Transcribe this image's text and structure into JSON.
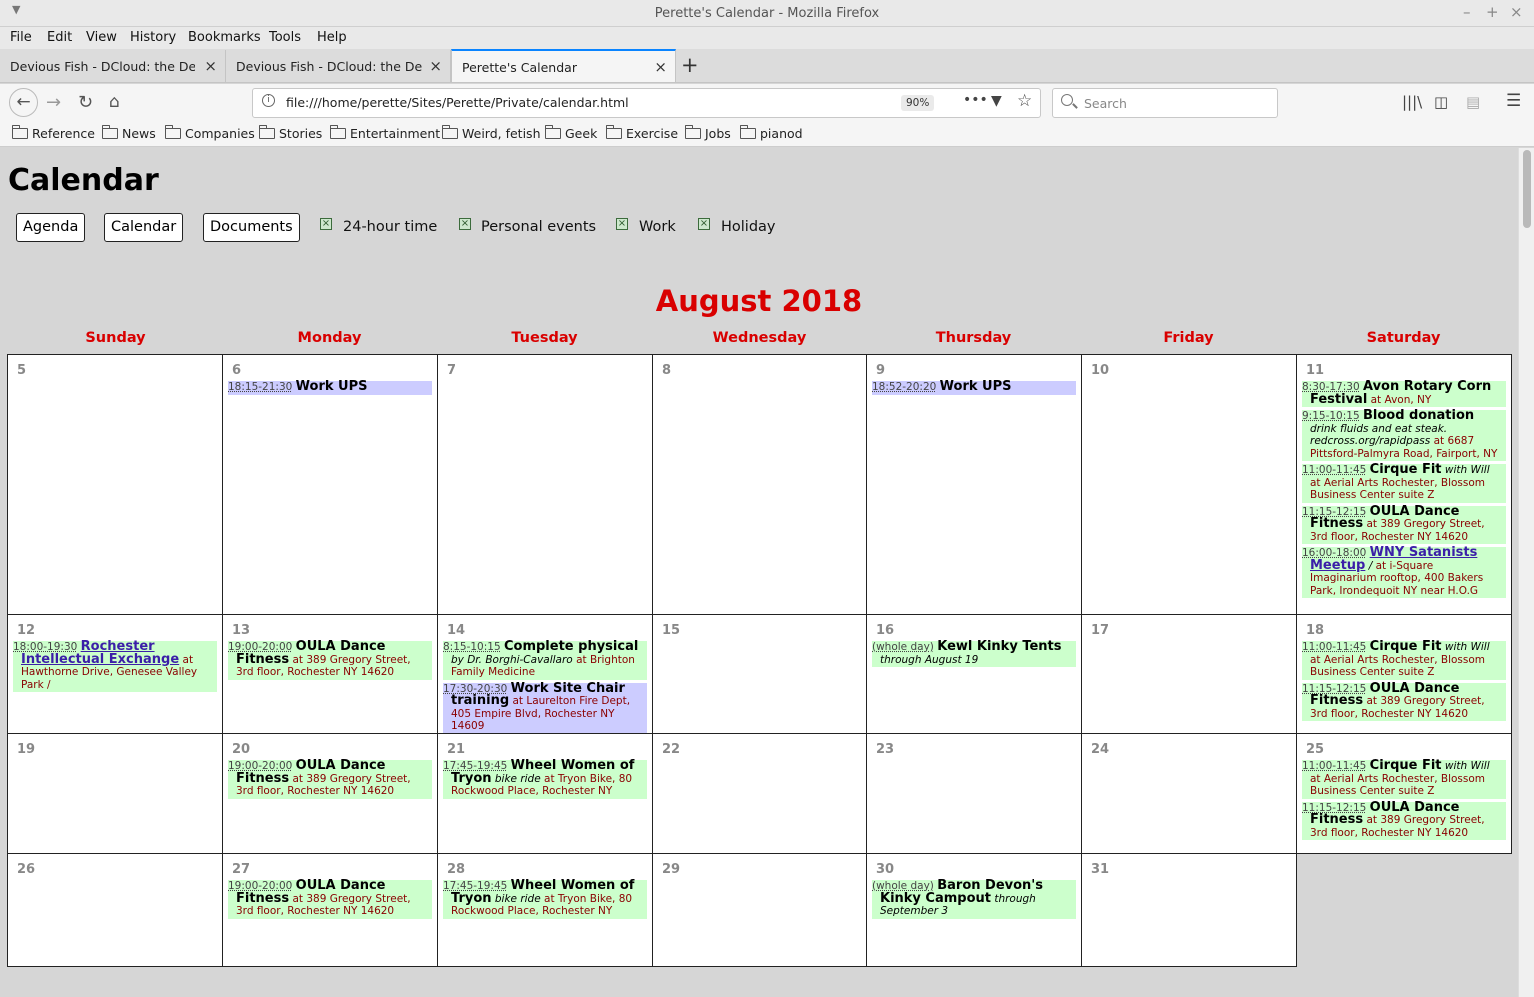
{
  "window": {
    "title": "Perette's Calendar - Mozilla Firefox"
  },
  "menu": [
    "File",
    "Edit",
    "View",
    "History",
    "Bookmarks",
    "Tools",
    "Help"
  ],
  "tabs": [
    {
      "label": "Devious Fish - DCloud: the Devio"
    },
    {
      "label": "Devious Fish - DCloud: the Devio"
    },
    {
      "label": "Perette's Calendar"
    }
  ],
  "nav": {
    "url": "file:///home/perette/Sites/Perette/Private/calendar.html",
    "zoom": "90%",
    "search_placeholder": "Search"
  },
  "bookmarks": [
    "Reference",
    "News",
    "Companies",
    "Stories",
    "Entertainment",
    "Weird, fetish",
    "Geek",
    "Exercise",
    "Jobs",
    "pianod"
  ],
  "page": {
    "title": "Calendar",
    "buttons": [
      "Agenda",
      "Calendar",
      "Documents"
    ],
    "toggles": [
      {
        "label": "24-hour time",
        "checked": true
      },
      {
        "label": "Personal events",
        "checked": true
      },
      {
        "label": "Work",
        "checked": true
      },
      {
        "label": "Holiday",
        "checked": true
      }
    ],
    "month": "August 2018",
    "weekdays": [
      "Sunday",
      "Monday",
      "Tuesday",
      "Wednesday",
      "Thursday",
      "Friday",
      "Saturday"
    ]
  },
  "weeks": [
    [
      {
        "day": "5",
        "events": []
      },
      {
        "day": "6",
        "events": [
          {
            "color": "b",
            "time": "18:15-21:30",
            "title": "Work UPS"
          }
        ]
      },
      {
        "day": "7",
        "events": []
      },
      {
        "day": "8",
        "events": []
      },
      {
        "day": "9",
        "events": [
          {
            "color": "b",
            "time": "18:52-20:20",
            "title": "Work UPS"
          }
        ]
      },
      {
        "day": "10",
        "events": []
      },
      {
        "day": "11",
        "events": [
          {
            "color": "g",
            "time": "8:30-17:30",
            "title": "Avon Rotary Corn Festival",
            "loc": "at Avon, NY"
          },
          {
            "color": "g",
            "time": "9:15-10:15",
            "title": "Blood donation",
            "note": "drink fluids and eat steak. redcross.org/rapidpass",
            "loc": "at 6687 Pittsford-Palmyra Road, Fairport, NY"
          },
          {
            "color": "g",
            "time": "11:00-11:45",
            "title": "Cirque Fit",
            "note": "with Will",
            "loc": "at Aerial Arts Rochester, Blossom Business Center suite Z"
          },
          {
            "color": "g",
            "time": "11:15-12:15",
            "title": "OULA Dance Fitness",
            "loc": "at 389 Gregory Street, 3rd floor, Rochester NY 14620"
          },
          {
            "color": "g",
            "time": "16:00-18:00",
            "title": "WNY Satanists Meetup",
            "link": true,
            "note": "/",
            "loc": "at i-Square Imaginarium rooftop, 400 Bakers Park, Irondequoit NY near H.O.G"
          }
        ]
      }
    ],
    [
      {
        "day": "12",
        "events": [
          {
            "color": "g",
            "time": "18:00-19:30",
            "title": "Rochester Intellectual Exchange",
            "link": true,
            "loc": "at Hawthorne Drive, Genesee Valley Park /"
          }
        ]
      },
      {
        "day": "13",
        "events": [
          {
            "color": "g",
            "time": "19:00-20:00",
            "title": "OULA Dance Fitness",
            "loc": "at 389 Gregory Street, 3rd floor, Rochester NY 14620"
          }
        ]
      },
      {
        "day": "14",
        "events": [
          {
            "color": "g",
            "time": "8:15-10:15",
            "title": "Complete physical",
            "note": "by Dr. Borghi-Cavallaro",
            "loc": "at Brighton Family Medicine"
          },
          {
            "color": "b",
            "time": "17:30-20:30",
            "title": "Work Site Chair training",
            "loc": "at Laurelton Fire Dept, 405 Empire Blvd, Rochester NY 14609"
          }
        ]
      },
      {
        "day": "15",
        "events": []
      },
      {
        "day": "16",
        "events": [
          {
            "color": "g",
            "time": "(whole day)",
            "title": "Kewl Kinky Tents",
            "note": "through August 19"
          }
        ]
      },
      {
        "day": "17",
        "events": []
      },
      {
        "day": "18",
        "events": [
          {
            "color": "g",
            "time": "11:00-11:45",
            "title": "Cirque Fit",
            "note": "with Will",
            "loc": "at Aerial Arts Rochester, Blossom Business Center suite Z"
          },
          {
            "color": "g",
            "time": "11:15-12:15",
            "title": "OULA Dance Fitness",
            "loc": "at 389 Gregory Street, 3rd floor, Rochester NY 14620"
          }
        ]
      }
    ],
    [
      {
        "day": "19",
        "events": []
      },
      {
        "day": "20",
        "events": [
          {
            "color": "g",
            "time": "19:00-20:00",
            "title": "OULA Dance Fitness",
            "loc": "at 389 Gregory Street, 3rd floor, Rochester NY 14620"
          }
        ]
      },
      {
        "day": "21",
        "events": [
          {
            "color": "g",
            "time": "17:45-19:45",
            "title": "Wheel Women of Tryon",
            "note": "bike ride",
            "loc": "at Tryon Bike, 80 Rockwood Place, Rochester NY"
          }
        ]
      },
      {
        "day": "22",
        "events": []
      },
      {
        "day": "23",
        "events": []
      },
      {
        "day": "24",
        "events": []
      },
      {
        "day": "25",
        "events": [
          {
            "color": "g",
            "time": "11:00-11:45",
            "title": "Cirque Fit",
            "note": "with Will",
            "loc": "at Aerial Arts Rochester, Blossom Business Center suite Z"
          },
          {
            "color": "g",
            "time": "11:15-12:15",
            "title": "OULA Dance Fitness",
            "loc": "at 389 Gregory Street, 3rd floor, Rochester NY 14620"
          }
        ]
      }
    ],
    [
      {
        "day": "26",
        "events": []
      },
      {
        "day": "27",
        "events": [
          {
            "color": "g",
            "time": "19:00-20:00",
            "title": "OULA Dance Fitness",
            "loc": "at 389 Gregory Street, 3rd floor, Rochester NY 14620"
          }
        ]
      },
      {
        "day": "28",
        "events": [
          {
            "color": "g",
            "time": "17:45-19:45",
            "title": "Wheel Women of Tryon",
            "note": "bike ride",
            "loc": "at Tryon Bike, 80 Rockwood Place, Rochester NY"
          }
        ]
      },
      {
        "day": "29",
        "events": []
      },
      {
        "day": "30",
        "events": [
          {
            "color": "g",
            "time": "(whole day)",
            "title": "Baron Devon's Kinky Campout",
            "note": "through September 3"
          }
        ]
      },
      {
        "day": "31",
        "events": []
      },
      null
    ]
  ]
}
